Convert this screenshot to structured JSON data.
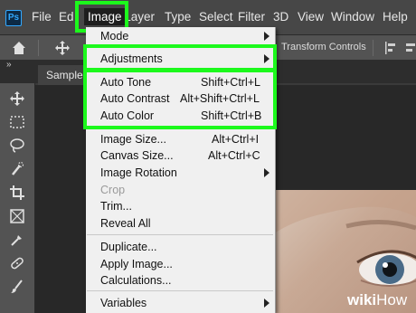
{
  "app": {
    "logo": "Ps"
  },
  "menubar": {
    "items": [
      "File",
      "Edit",
      "Image",
      "Layer",
      "Type",
      "Select",
      "Filter",
      "3D",
      "View",
      "Window",
      "Help"
    ],
    "active": "Image"
  },
  "options": {
    "show_transform_controls_label": "Transform Controls"
  },
  "tabs": {
    "collapse": "»",
    "document_tab": "Sample.jpg"
  },
  "image_menu": {
    "mode": "Mode",
    "adjustments": "Adjustments",
    "auto_tone": {
      "label": "Auto Tone",
      "shortcut": "Shift+Ctrl+L"
    },
    "auto_contrast": {
      "label": "Auto Contrast",
      "shortcut": "Alt+Shift+Ctrl+L"
    },
    "auto_color": {
      "label": "Auto Color",
      "shortcut": "Shift+Ctrl+B"
    },
    "image_size": {
      "label": "Image Size...",
      "shortcut": "Alt+Ctrl+I"
    },
    "canvas_size": {
      "label": "Canvas Size...",
      "shortcut": "Alt+Ctrl+C"
    },
    "image_rotation": "Image Rotation",
    "crop": "Crop",
    "trim": "Trim...",
    "reveal_all": "Reveal All",
    "duplicate": "Duplicate...",
    "apply_image": "Apply Image...",
    "calculations": "Calculations...",
    "variables": "Variables"
  },
  "watermark": {
    "wiki": "wiki",
    "how": "How"
  },
  "highlight_color": "#1cf91c",
  "icons": [
    "home-icon",
    "move-icon",
    "marquee-icon",
    "lasso-icon",
    "quick-selection-icon",
    "crop-icon",
    "frame-icon",
    "eyedropper-icon",
    "healing-brush-icon",
    "brush-icon",
    "align-icon"
  ]
}
